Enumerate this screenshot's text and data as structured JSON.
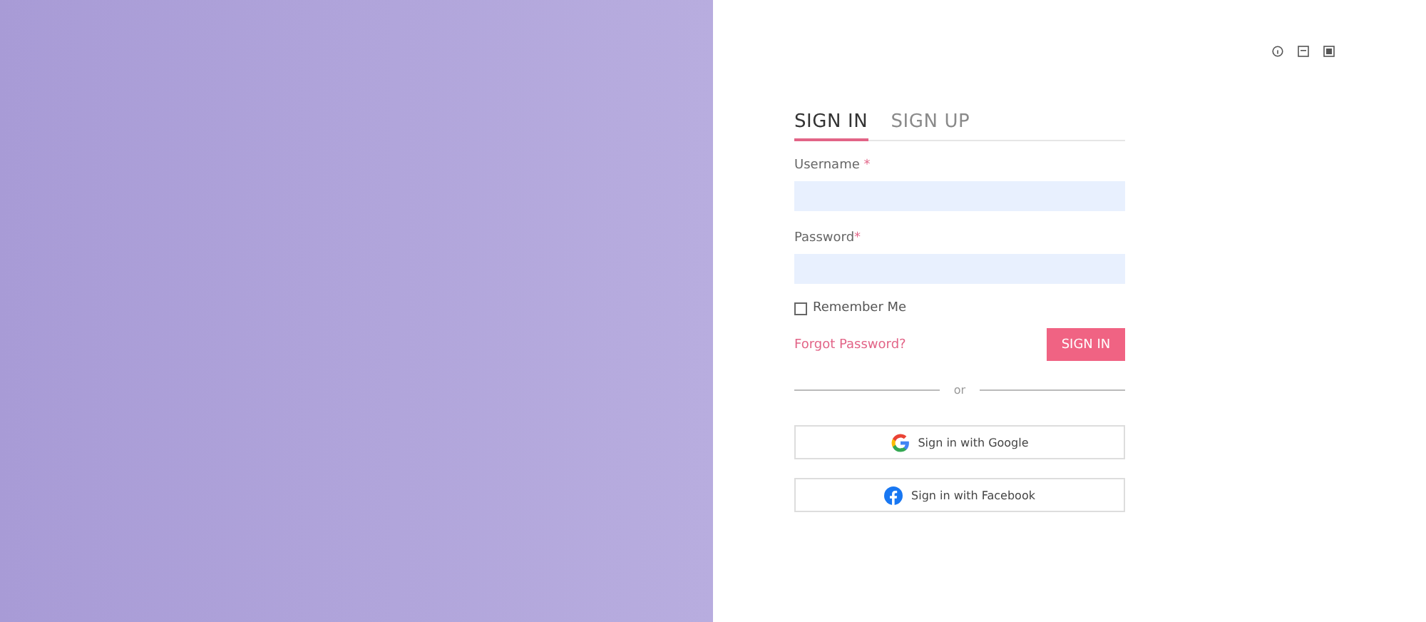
{
  "tabs": [
    {
      "label": "SIGN IN",
      "selected": true
    },
    {
      "label": "SIGN UP",
      "selected": false
    }
  ],
  "fields": [
    {
      "label": "Username",
      "required_mark": " *"
    },
    {
      "label": "Password",
      "required_mark": "*"
    }
  ],
  "remember": {
    "label": "Remember Me",
    "checked": false
  },
  "forgot_link": "Forgot Password?",
  "submit": "SIGN IN",
  "divider_text": "or",
  "social_buttons": [
    {
      "kind": "google",
      "label": "Sign in with Google"
    },
    {
      "kind": "facebook",
      "label": "Sign in with Facebook"
    }
  ]
}
